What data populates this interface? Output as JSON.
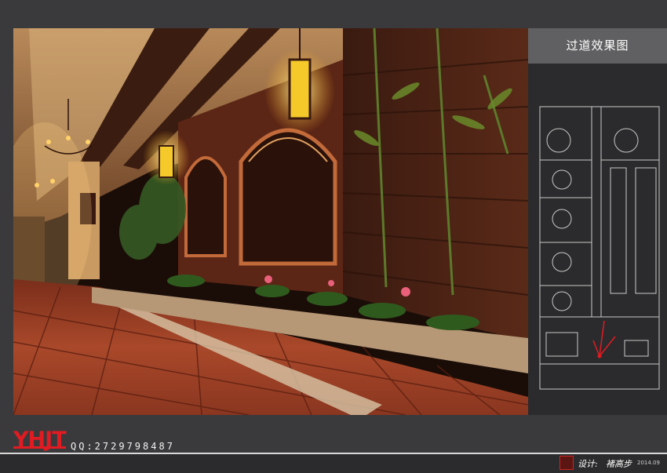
{
  "panel": {
    "title": "过道效果图"
  },
  "brand": {
    "logo_text": "YHJT",
    "qq": "QQ:2729798487"
  },
  "footer": {
    "designer_label": "设计:",
    "designer_name": "褚高步",
    "date": "2014.09"
  },
  "colors": {
    "background": "#3a3a3c",
    "title_box": "#606062",
    "brand_red": "#e11b22",
    "floor_tile": "#a9482a",
    "plan_line": "#c8c8c8"
  }
}
